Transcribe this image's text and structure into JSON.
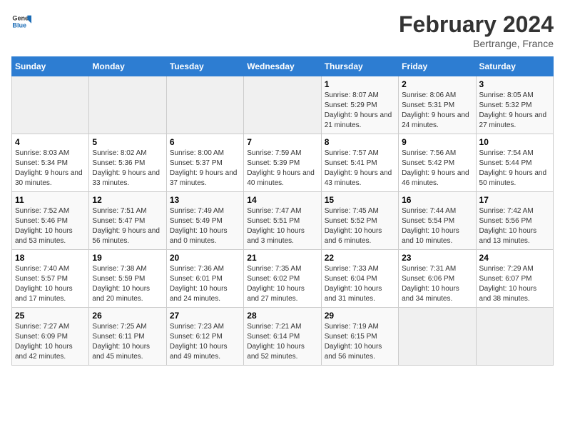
{
  "header": {
    "logo_general": "General",
    "logo_blue": "Blue",
    "title": "February 2024",
    "subtitle": "Bertrange, France"
  },
  "calendar": {
    "weekdays": [
      "Sunday",
      "Monday",
      "Tuesday",
      "Wednesday",
      "Thursday",
      "Friday",
      "Saturday"
    ],
    "rows": [
      [
        {
          "day": "",
          "sunrise": "",
          "sunset": "",
          "daylight": ""
        },
        {
          "day": "",
          "sunrise": "",
          "sunset": "",
          "daylight": ""
        },
        {
          "day": "",
          "sunrise": "",
          "sunset": "",
          "daylight": ""
        },
        {
          "day": "",
          "sunrise": "",
          "sunset": "",
          "daylight": ""
        },
        {
          "day": "1",
          "sunrise": "8:07 AM",
          "sunset": "5:29 PM",
          "daylight": "9 hours and 21 minutes."
        },
        {
          "day": "2",
          "sunrise": "8:06 AM",
          "sunset": "5:31 PM",
          "daylight": "9 hours and 24 minutes."
        },
        {
          "day": "3",
          "sunrise": "8:05 AM",
          "sunset": "5:32 PM",
          "daylight": "9 hours and 27 minutes."
        }
      ],
      [
        {
          "day": "4",
          "sunrise": "8:03 AM",
          "sunset": "5:34 PM",
          "daylight": "9 hours and 30 minutes."
        },
        {
          "day": "5",
          "sunrise": "8:02 AM",
          "sunset": "5:36 PM",
          "daylight": "9 hours and 33 minutes."
        },
        {
          "day": "6",
          "sunrise": "8:00 AM",
          "sunset": "5:37 PM",
          "daylight": "9 hours and 37 minutes."
        },
        {
          "day": "7",
          "sunrise": "7:59 AM",
          "sunset": "5:39 PM",
          "daylight": "9 hours and 40 minutes."
        },
        {
          "day": "8",
          "sunrise": "7:57 AM",
          "sunset": "5:41 PM",
          "daylight": "9 hours and 43 minutes."
        },
        {
          "day": "9",
          "sunrise": "7:56 AM",
          "sunset": "5:42 PM",
          "daylight": "9 hours and 46 minutes."
        },
        {
          "day": "10",
          "sunrise": "7:54 AM",
          "sunset": "5:44 PM",
          "daylight": "9 hours and 50 minutes."
        }
      ],
      [
        {
          "day": "11",
          "sunrise": "7:52 AM",
          "sunset": "5:46 PM",
          "daylight": "10 hours and 53 minutes."
        },
        {
          "day": "12",
          "sunrise": "7:51 AM",
          "sunset": "5:47 PM",
          "daylight": "9 hours and 56 minutes."
        },
        {
          "day": "13",
          "sunrise": "7:49 AM",
          "sunset": "5:49 PM",
          "daylight": "10 hours and 0 minutes."
        },
        {
          "day": "14",
          "sunrise": "7:47 AM",
          "sunset": "5:51 PM",
          "daylight": "10 hours and 3 minutes."
        },
        {
          "day": "15",
          "sunrise": "7:45 AM",
          "sunset": "5:52 PM",
          "daylight": "10 hours and 6 minutes."
        },
        {
          "day": "16",
          "sunrise": "7:44 AM",
          "sunset": "5:54 PM",
          "daylight": "10 hours and 10 minutes."
        },
        {
          "day": "17",
          "sunrise": "7:42 AM",
          "sunset": "5:56 PM",
          "daylight": "10 hours and 13 minutes."
        }
      ],
      [
        {
          "day": "18",
          "sunrise": "7:40 AM",
          "sunset": "5:57 PM",
          "daylight": "10 hours and 17 minutes."
        },
        {
          "day": "19",
          "sunrise": "7:38 AM",
          "sunset": "5:59 PM",
          "daylight": "10 hours and 20 minutes."
        },
        {
          "day": "20",
          "sunrise": "7:36 AM",
          "sunset": "6:01 PM",
          "daylight": "10 hours and 24 minutes."
        },
        {
          "day": "21",
          "sunrise": "7:35 AM",
          "sunset": "6:02 PM",
          "daylight": "10 hours and 27 minutes."
        },
        {
          "day": "22",
          "sunrise": "7:33 AM",
          "sunset": "6:04 PM",
          "daylight": "10 hours and 31 minutes."
        },
        {
          "day": "23",
          "sunrise": "7:31 AM",
          "sunset": "6:06 PM",
          "daylight": "10 hours and 34 minutes."
        },
        {
          "day": "24",
          "sunrise": "7:29 AM",
          "sunset": "6:07 PM",
          "daylight": "10 hours and 38 minutes."
        }
      ],
      [
        {
          "day": "25",
          "sunrise": "7:27 AM",
          "sunset": "6:09 PM",
          "daylight": "10 hours and 42 minutes."
        },
        {
          "day": "26",
          "sunrise": "7:25 AM",
          "sunset": "6:11 PM",
          "daylight": "10 hours and 45 minutes."
        },
        {
          "day": "27",
          "sunrise": "7:23 AM",
          "sunset": "6:12 PM",
          "daylight": "10 hours and 49 minutes."
        },
        {
          "day": "28",
          "sunrise": "7:21 AM",
          "sunset": "6:14 PM",
          "daylight": "10 hours and 52 minutes."
        },
        {
          "day": "29",
          "sunrise": "7:19 AM",
          "sunset": "6:15 PM",
          "daylight": "10 hours and 56 minutes."
        },
        {
          "day": "",
          "sunrise": "",
          "sunset": "",
          "daylight": ""
        },
        {
          "day": "",
          "sunrise": "",
          "sunset": "",
          "daylight": ""
        }
      ]
    ]
  }
}
